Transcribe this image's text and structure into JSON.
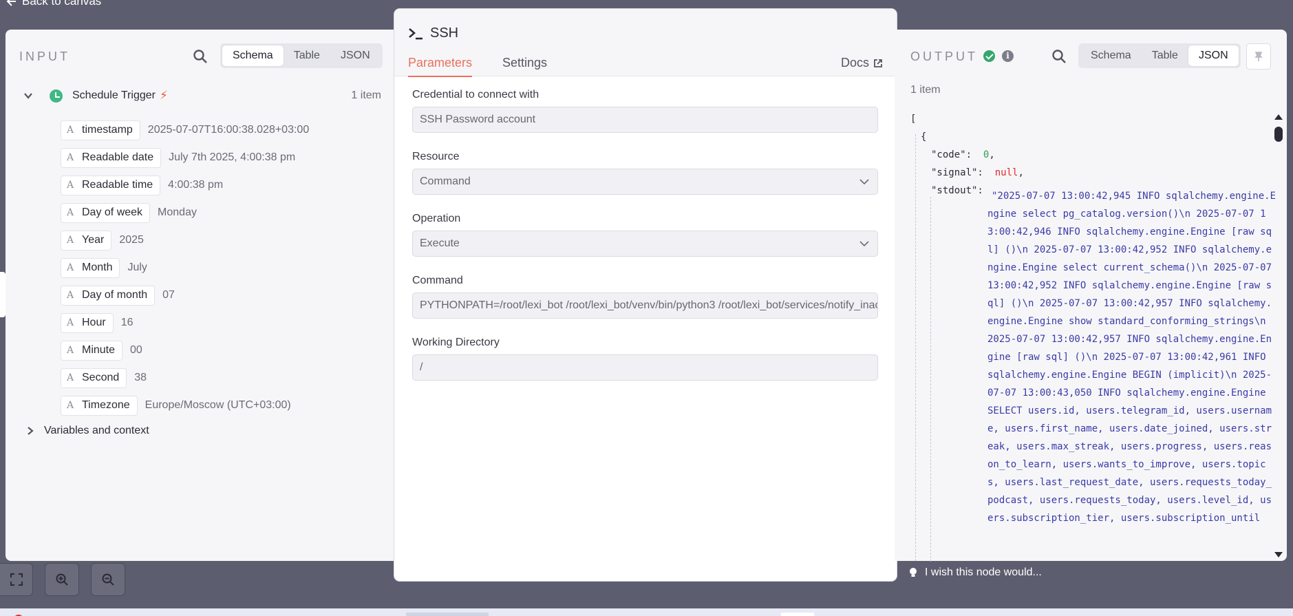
{
  "back_link": {
    "label": "Back to canvas"
  },
  "input_panel": {
    "title": "INPUT",
    "tabs": [
      "Schema",
      "Table",
      "JSON"
    ],
    "active_tab": "Schema",
    "trigger": {
      "name": "Schedule Trigger",
      "count": "1 item"
    },
    "fields": [
      {
        "name": "timestamp",
        "value": "2025-07-07T16:00:38.028+03:00"
      },
      {
        "name": "Readable date",
        "value": "July 7th 2025, 4:00:38 pm"
      },
      {
        "name": "Readable time",
        "value": "4:00:38 pm"
      },
      {
        "name": "Day of week",
        "value": "Monday"
      },
      {
        "name": "Year",
        "value": "2025"
      },
      {
        "name": "Month",
        "value": "July"
      },
      {
        "name": "Day of month",
        "value": "07"
      },
      {
        "name": "Hour",
        "value": "16"
      },
      {
        "name": "Minute",
        "value": "00"
      },
      {
        "name": "Second",
        "value": "38"
      },
      {
        "name": "Timezone",
        "value": "Europe/Moscow (UTC+03:00)"
      }
    ],
    "field_type_glyph": "A",
    "variables_label": "Variables and context"
  },
  "node": {
    "title": "SSH",
    "tabs": {
      "parameters": "Parameters",
      "settings": "Settings"
    },
    "docs_label": "Docs",
    "form": {
      "credential": {
        "label": "Credential to connect with",
        "value": "SSH Password account"
      },
      "resource": {
        "label": "Resource",
        "value": "Command"
      },
      "operation": {
        "label": "Operation",
        "value": "Execute"
      },
      "command": {
        "label": "Command",
        "value": "PYTHONPATH=/root/lexi_bot /root/lexi_bot/venv/bin/python3 /root/lexi_bot/services/notify_inactive_users.py"
      },
      "working_dir": {
        "label": "Working Directory",
        "value": "/"
      }
    }
  },
  "output_panel": {
    "title": "OUTPUT",
    "tabs": [
      "Schema",
      "Table",
      "JSON"
    ],
    "active_tab": "JSON",
    "count": "1 item",
    "json": {
      "open_bracket": "[",
      "open_brace": "{",
      "code_key": "\"code\":",
      "code_val": "0",
      "signal_key": "\"signal\":",
      "signal_val": "null",
      "stdout_key": "\"stdout\":",
      "stdout_val": "\"2025-07-07 13:00:42,945 INFO sqlalchemy.engine.Engine select pg_catalog.version()\\n 2025-07-07 13:00:42,946 INFO sqlalchemy.engine.Engine [raw sql] ()\\n 2025-07-07 13:00:42,952 INFO sqlalchemy.engine.Engine select current_schema()\\n 2025-07-07 13:00:42,952 INFO sqlalchemy.engine.Engine [raw sql] ()\\n 2025-07-07 13:00:42,957 INFO sqlalchemy.engine.Engine show standard_conforming_strings\\n 2025-07-07 13:00:42,957 INFO sqlalchemy.engine.Engine [raw sql] ()\\n 2025-07-07 13:00:42,961 INFO sqlalchemy.engine.Engine BEGIN (implicit)\\n 2025-07-07 13:00:43,050 INFO sqlalchemy.engine.Engine SELECT users.id, users.telegram_id, users.username, users.first_name, users.date_joined, users.streak, users.max_streak, users.progress, users.reason_to_learn, users.wants_to_improve, users.topics, users.last_request_date, users.requests_today_podcast, users.requests_today, users.level_id, users.subscription_tier, users.subscription_until"
    }
  },
  "wish_label": "I wish this node would...",
  "colors": {
    "accent": "#e8715c",
    "success": "#36a66b",
    "string": "#3a3aa8",
    "number": "#2e9f52",
    "null": "#e02b2b"
  },
  "icons": [
    "arrow-left-icon",
    "search-icon",
    "chevron-down-icon",
    "clock-icon",
    "bolt-icon",
    "terminal-icon",
    "external-link-icon",
    "check-circle-icon",
    "info-icon",
    "pin-icon",
    "fit-view-icon",
    "zoom-in-icon",
    "zoom-out-icon",
    "lightbulb-icon"
  ]
}
